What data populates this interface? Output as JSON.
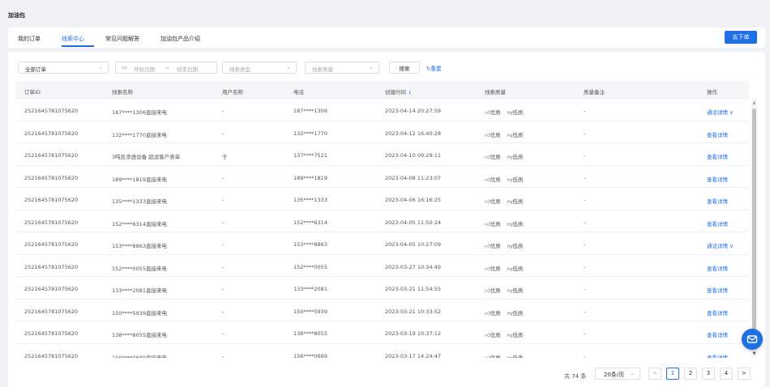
{
  "page_title": "加油包",
  "tabs": [
    {
      "label": "我的订单"
    },
    {
      "label": "线索中心"
    },
    {
      "label": "常见问题解答"
    },
    {
      "label": "加油包产品介绍"
    }
  ],
  "order_button": "去下单",
  "filters": {
    "order_select": "全部订单",
    "date_start_placeholder": "开始日期",
    "date_separator": "→",
    "date_end_placeholder": "结束日期",
    "lead_type_placeholder": "线索类型",
    "lead_quality_placeholder": "线索质量",
    "search_label": "搜索",
    "reset_label": "重置"
  },
  "table": {
    "columns": [
      "订单ID",
      "线索名称",
      "用户名称",
      "电话",
      "创建时间",
      "线索质量",
      "质量备注",
      "操作"
    ],
    "sort_icon": "↓",
    "quality_good": "优质",
    "quality_bad": "低质",
    "rows": [
      {
        "order_id": "2521645781075620",
        "lead": "187****1306直接来电",
        "user": "-",
        "phone": "187****1306",
        "time": "2023-04-14 20:27:59",
        "note": "-",
        "action": "通话详情 ∨"
      },
      {
        "order_id": "2521645781075620",
        "lead": "132****1770直接来电",
        "user": "-",
        "phone": "132****1770",
        "time": "2023-04-12 16:40:28",
        "note": "-",
        "action": "查看详情"
      },
      {
        "order_id": "2521645781075620",
        "lead": "3吨反渗透设备 超滤客户表单",
        "user": "于",
        "phone": "137****7521",
        "time": "2023-04-10 09:29:11",
        "note": "-",
        "action": "查看详情"
      },
      {
        "order_id": "2521645781075620",
        "lead": "189****1819直接来电",
        "user": "-",
        "phone": "189****1819",
        "time": "2023-04-08 11:23:07",
        "note": "-",
        "action": "查看详情"
      },
      {
        "order_id": "2521645781075620",
        "lead": "135****1333直接来电",
        "user": "-",
        "phone": "135****1333",
        "time": "2023-04-06 16:16:25",
        "note": "-",
        "action": "查看详情"
      },
      {
        "order_id": "2521645781075620",
        "lead": "152****6314直接来电",
        "user": "-",
        "phone": "152****6314",
        "time": "2023-04-05 11:50:24",
        "note": "-",
        "action": "查看详情"
      },
      {
        "order_id": "2521645781075620",
        "lead": "153****8863直接来电",
        "user": "-",
        "phone": "153****8863",
        "time": "2023-04-05 10:27:09",
        "note": "-",
        "action": "通话详情 ∨"
      },
      {
        "order_id": "2521645781075620",
        "lead": "152****0055直接来电",
        "user": "-",
        "phone": "152****0055",
        "time": "2023-03-27 10:34:49",
        "note": "-",
        "action": "查看详情"
      },
      {
        "order_id": "2521645781075620",
        "lead": "133****2081直接来电",
        "user": "-",
        "phone": "133****2081",
        "time": "2023-03-21 11:54:55",
        "note": "-",
        "action": "查看详情"
      },
      {
        "order_id": "2521645781075620",
        "lead": "150****5939直接来电",
        "user": "-",
        "phone": "150****5939",
        "time": "2023-03-21 10:33:52",
        "note": "-",
        "action": "查看详情"
      },
      {
        "order_id": "2521645781075620",
        "lead": "138****8055直接来电",
        "user": "-",
        "phone": "138****8055",
        "time": "2023-03-19 10:37:12",
        "note": "-",
        "action": "查看详情"
      },
      {
        "order_id": "2521645781075620",
        "lead": "156****0689直接来电",
        "user": "-",
        "phone": "156****0689",
        "time": "2023-03-17 14:24:47",
        "note": "-",
        "action": "查看详情"
      }
    ]
  },
  "pagination": {
    "total": "共 74 条",
    "page_size": "20条/页",
    "prev": "<",
    "next": ">",
    "pages": [
      "1",
      "2",
      "3",
      "4"
    ],
    "current": 1
  },
  "colors": {
    "accent": "#1f6fe5"
  },
  "icons": {
    "fab": "mail-icon",
    "thumb_up": "thumb-up-icon",
    "thumb_down": "thumb-down-icon"
  }
}
